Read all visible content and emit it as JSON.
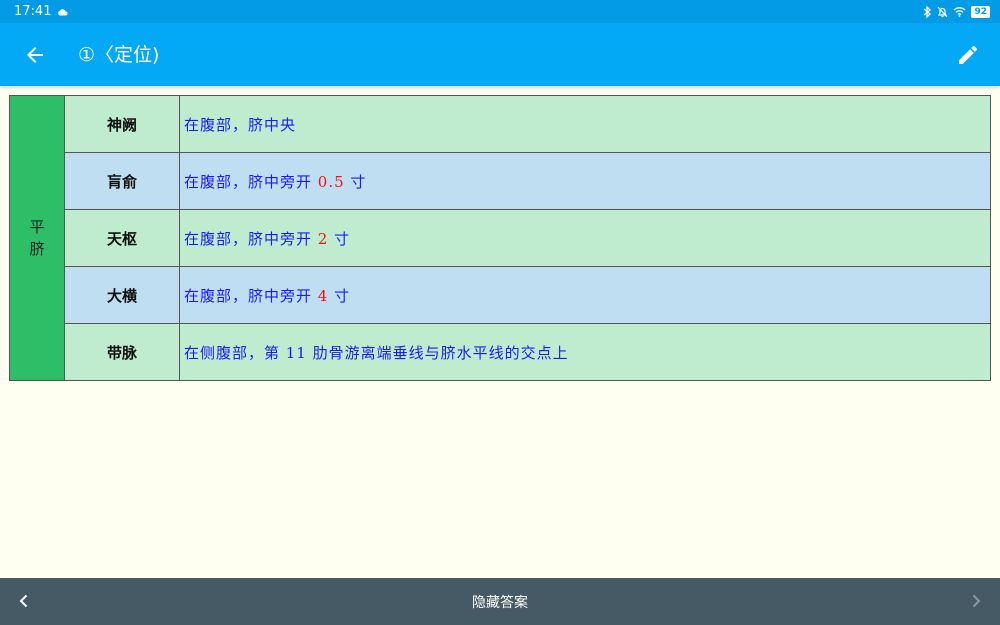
{
  "status": {
    "time": "17:41",
    "battery": "92"
  },
  "header": {
    "title": "①〈定位)"
  },
  "group": {
    "label_line1": "平",
    "label_line2": "脐"
  },
  "rows": [
    {
      "name": "神阙",
      "text_before": "在腹部，脐中央",
      "number": "",
      "text_after": ""
    },
    {
      "name": "肓俞",
      "text_before": "在腹部，脐中旁开 ",
      "number": "0.5",
      "text_after": " 寸"
    },
    {
      "name": "天枢",
      "text_before": "在腹部，脐中旁开 ",
      "number": "2",
      "text_after": " 寸"
    },
    {
      "name": "大横",
      "text_before": "在腹部，脐中旁开 ",
      "number": "4",
      "text_after": " 寸"
    },
    {
      "name": "带脉",
      "text_before": "在侧腹部，第 11 肋骨游离端垂线与脐水平线的交点上",
      "number": "",
      "text_after": ""
    }
  ],
  "footer": {
    "hide_answer_label": "隐藏答案"
  },
  "colors": {
    "status_bar": "#039be5",
    "app_bar": "#03a9f4",
    "group_cell": "#2dbe67",
    "row_green": "#bfeccf",
    "row_blue": "#c0def2",
    "desc_text": "#1a1aff",
    "number_text": "#ee1111",
    "bottom_bar": "#455a64",
    "background": "#fefff0"
  },
  "icons": {
    "back": "arrow-back-icon",
    "edit": "pencil-icon",
    "prev": "chevron-left-icon",
    "next": "chevron-right-icon",
    "bluetooth": "bluetooth-icon",
    "mute": "bell-off-icon",
    "wifi": "wifi-icon"
  }
}
